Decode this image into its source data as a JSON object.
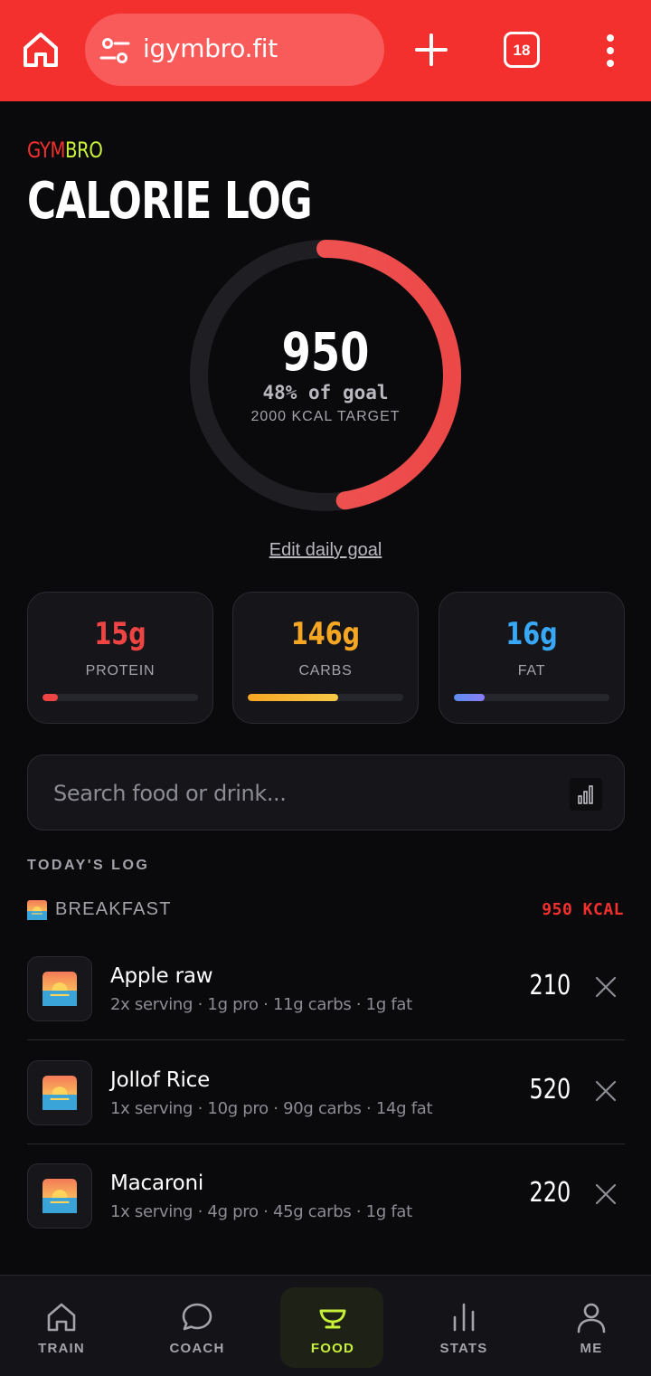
{
  "browser": {
    "url": "igymbro.fit",
    "tab_count": "18"
  },
  "header": {
    "brand_part1": "GYM",
    "brand_part2": "BRO",
    "title": "CALORIE LOG"
  },
  "summary": {
    "calories": "950",
    "percent_text": "48% of goal",
    "target_text": "2000 KCAL TARGET",
    "progress_fraction": 0.475,
    "edit_goal": "Edit daily goal",
    "ring_color": "#f4302f"
  },
  "macros": [
    {
      "value": "15g",
      "label": "PROTEIN",
      "color": "#ef4444",
      "fill_fraction": 0.1
    },
    {
      "value": "146g",
      "label": "CARBS",
      "color": "#f5a623",
      "fill_fraction": 0.58
    },
    {
      "value": "16g",
      "label": "FAT",
      "color": "#38a7f5",
      "fill_fraction": 0.2
    }
  ],
  "search": {
    "placeholder": "Search food or drink...",
    "icon": "barcode-scan-icon"
  },
  "log": {
    "section_title": "TODAY'S LOG",
    "meals": [
      {
        "name": "BREAKFAST",
        "kcal": "950 KCAL",
        "icon": "sunrise-icon",
        "items": [
          {
            "name": "Apple raw",
            "meta": "2x serving · 1g pro · 11g carbs · 1g fat",
            "kcal": "210"
          },
          {
            "name": "Jollof Rice",
            "meta": "1x serving · 10g pro · 90g carbs · 14g fat",
            "kcal": "520"
          },
          {
            "name": "Macaroni",
            "meta": "1x serving · 4g pro · 45g carbs · 1g fat",
            "kcal": "220"
          }
        ]
      }
    ]
  },
  "nav": {
    "items": [
      {
        "label": "TRAIN",
        "icon": "home-icon"
      },
      {
        "label": "COACH",
        "icon": "chat-bubble-icon"
      },
      {
        "label": "FOOD",
        "icon": "bowl-icon",
        "active": true
      },
      {
        "label": "STATS",
        "icon": "bar-chart-icon"
      },
      {
        "label": "ME",
        "icon": "person-icon"
      }
    ],
    "active_color": "#c8f03a"
  }
}
